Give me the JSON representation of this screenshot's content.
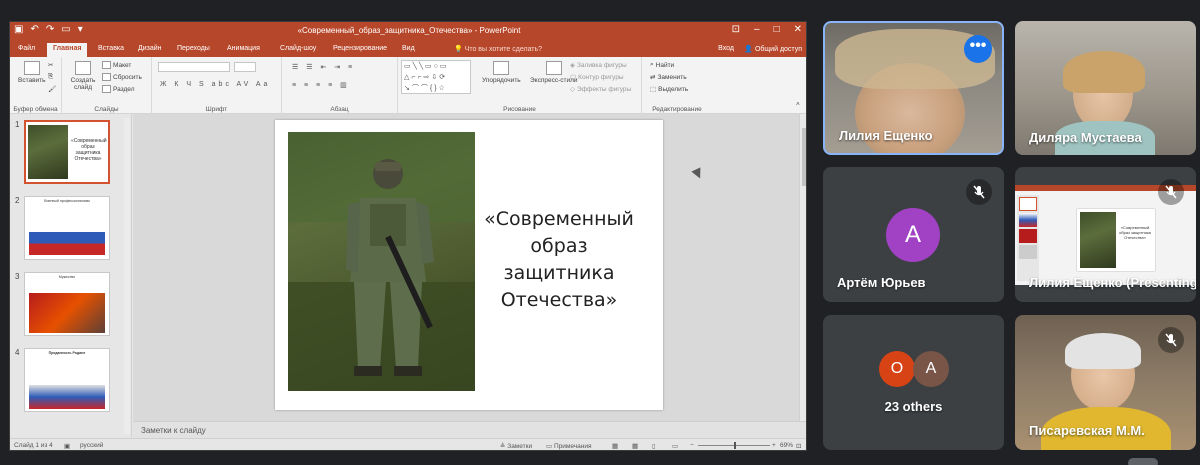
{
  "powerpoint": {
    "window_title": "«Современный_образ_защитника_Отечества» - PowerPoint",
    "tabs": [
      "Файл",
      "Главная",
      "Вставка",
      "Дизайн",
      "Переходы",
      "Анимация",
      "Слайд-шоу",
      "Рецензирование",
      "Вид"
    ],
    "active_tab": "Главная",
    "search_placeholder": "Что вы хотите сделать?",
    "signin": "Вход",
    "share": "Общий доступ",
    "ribbon": {
      "clipboard": {
        "label": "Буфер обмена",
        "paste": "Вставить"
      },
      "slides": {
        "label": "Слайды",
        "new_slide": "Создать слайд",
        "layout": "Макет",
        "reset": "Сбросить",
        "section": "Раздел"
      },
      "font": {
        "label": "Шрифт"
      },
      "paragraph": {
        "label": "Абзац"
      },
      "drawing": {
        "label": "Рисование",
        "arrange": "Упорядочить",
        "quick_styles": "Экспресс-стили",
        "fill": "Заливка фигуры",
        "outline": "Контур фигуры",
        "effects": "Эффекты фигуры"
      },
      "editing": {
        "label": "Редактирование",
        "find": "Найти",
        "replace": "Заменить",
        "select": "Выделить"
      }
    },
    "slide_numbers": [
      "1",
      "2",
      "3",
      "4"
    ],
    "thumbnails": [
      {
        "text": "«Современный образ защитника Отечества»"
      },
      {
        "text": "Военный профессионализм"
      },
      {
        "text": "Мужество"
      },
      {
        "text": "Преданность Родине"
      }
    ],
    "slide": {
      "title": "«Современный образ защитника Отечества»"
    },
    "notes_placeholder": "Заметки к слайду",
    "status": {
      "slide_info": "Слайд 1 из 4",
      "language": "русский",
      "notes": "Заметки",
      "comments": "Примечания",
      "zoom": "69%"
    }
  },
  "meet": {
    "participants": [
      {
        "name": "Лилия Ещенко",
        "active_speaker": true
      },
      {
        "name": "Диляра Мустаева"
      },
      {
        "name": "Артём Юрьев",
        "initial": "A",
        "avatar_color": "#9c27b0",
        "muted": true
      },
      {
        "name": "Лилия Ещенко (Presenting)",
        "muted": true
      },
      {
        "name": "Писаревская М.М.",
        "muted": true
      }
    ],
    "others": {
      "label": "23 others",
      "avatars": [
        {
          "initial": "O",
          "color": "#d84315"
        },
        {
          "initial": "A",
          "color": "#795548"
        }
      ]
    },
    "more_options_icon": "more-vert-icon"
  }
}
